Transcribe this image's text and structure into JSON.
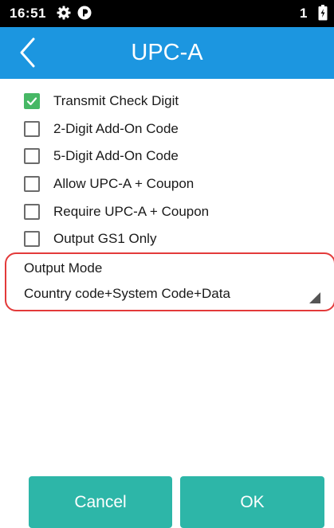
{
  "status_bar": {
    "time": "16:51",
    "sim_indicator": "1",
    "icons": [
      "gear-icon",
      "app-notification-icon",
      "battery-charging-icon"
    ]
  },
  "app_bar": {
    "title": "UPC-A",
    "back_icon": "chevron-left-icon",
    "background_color": "#1c96e0"
  },
  "options": [
    {
      "label": "Transmit Check Digit",
      "checked": true
    },
    {
      "label": "2-Digit Add-On Code",
      "checked": false
    },
    {
      "label": "5-Digit Add-On Code",
      "checked": false
    },
    {
      "label": "Allow UPC-A + Coupon",
      "checked": false
    },
    {
      "label": "Require UPC-A + Coupon",
      "checked": false
    },
    {
      "label": "Output GS1 Only",
      "checked": false
    }
  ],
  "output_mode": {
    "label": "Output Mode",
    "selected": "Country code+System Code+Data",
    "highlight_color": "#e33a3a"
  },
  "buttons": {
    "cancel": "Cancel",
    "ok": "OK",
    "color": "#2db6a8"
  },
  "colors": {
    "checked": "#47b865"
  }
}
